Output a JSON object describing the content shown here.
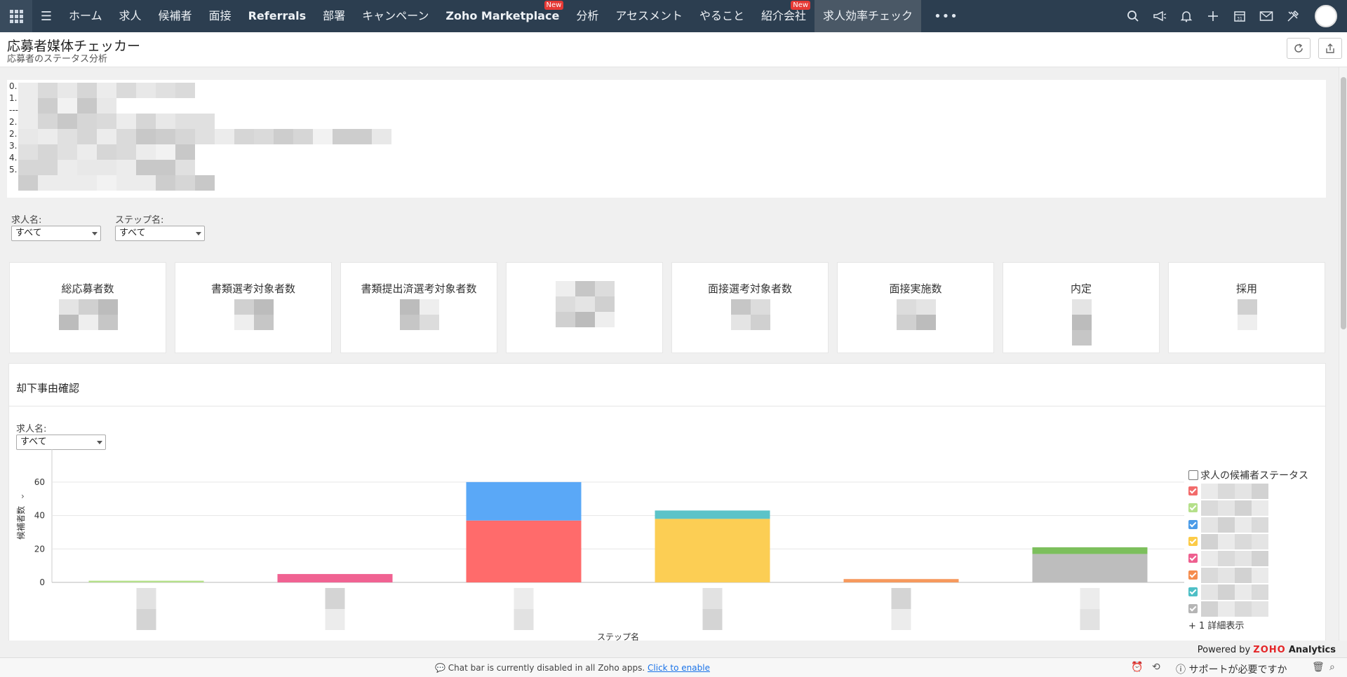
{
  "nav": {
    "items": [
      {
        "label": "ホーム",
        "bold": false,
        "badge": "",
        "active": false
      },
      {
        "label": "求人",
        "bold": false,
        "badge": "",
        "active": false
      },
      {
        "label": "候補者",
        "bold": false,
        "badge": "",
        "active": false
      },
      {
        "label": "面接",
        "bold": false,
        "badge": "",
        "active": false
      },
      {
        "label": "Referrals",
        "bold": true,
        "badge": "",
        "active": false
      },
      {
        "label": "部署",
        "bold": false,
        "badge": "",
        "active": false
      },
      {
        "label": "キャンペーン",
        "bold": false,
        "badge": "",
        "active": false
      },
      {
        "label": "Zoho Marketplace",
        "bold": true,
        "badge": "New",
        "active": false
      },
      {
        "label": "分析",
        "bold": false,
        "badge": "",
        "active": false
      },
      {
        "label": "アセスメント",
        "bold": false,
        "badge": "",
        "active": false
      },
      {
        "label": "やること",
        "bold": false,
        "badge": "",
        "active": false
      },
      {
        "label": "紹介会社",
        "bold": false,
        "badge": "New",
        "active": false
      },
      {
        "label": "求人効率チェック",
        "bold": false,
        "badge": "",
        "active": true
      }
    ],
    "more_label": "•••",
    "right_icons": [
      "search-icon",
      "megaphone-icon",
      "bell-icon",
      "plus-icon",
      "calendar-icon",
      "mail-icon",
      "tools-icon"
    ]
  },
  "header": {
    "title": "応募者媒体チェッカー",
    "subtitle": "応募者のステータス分析"
  },
  "info": {
    "lines": [
      "0.",
      "1.",
      "---",
      "2.",
      "2.",
      "3.",
      "4.",
      "5."
    ]
  },
  "filters": {
    "job_label": "求人名:",
    "job_value": "すべて",
    "step_label": "ステップ名:",
    "step_value": "すべて"
  },
  "kpis": [
    "総応募者数",
    "書類選考対象者数",
    "書類提出済選考対象者数",
    "",
    "面接選考対象者数",
    "面接実施数",
    "内定",
    "採用"
  ],
  "rejection": {
    "title": "却下事由確認",
    "job_label": "求人名:",
    "job_value": "すべて"
  },
  "chart_data": {
    "type": "bar",
    "stacked": true,
    "ylabel": "候補者数",
    "xlabel": "ステップ名",
    "yticks": [
      0,
      20,
      40,
      60
    ],
    "ylim": [
      0,
      70
    ],
    "categories": [
      "",
      "",
      "",
      "",
      "",
      ""
    ],
    "series": [
      {
        "color": "#ff6b6b",
        "values": [
          0,
          0,
          37,
          0,
          0,
          0
        ]
      },
      {
        "color": "#b5e08a",
        "values": [
          1,
          0,
          0,
          0,
          0,
          0
        ]
      },
      {
        "color": "#5aa8f7",
        "values": [
          0,
          0,
          23,
          0,
          0,
          0
        ]
      },
      {
        "color": "#fcce54",
        "values": [
          0,
          0,
          0,
          38,
          0,
          0
        ]
      },
      {
        "color": "#f06292",
        "values": [
          0,
          5,
          0,
          0,
          0,
          0
        ]
      },
      {
        "color": "#f6995d",
        "values": [
          0,
          0,
          0,
          0,
          2,
          0
        ]
      },
      {
        "color": "#5cc3c8",
        "values": [
          0,
          0,
          0,
          5,
          0,
          0
        ]
      },
      {
        "color": "#bdbdbd",
        "values": [
          0,
          0,
          0,
          0,
          0,
          17
        ]
      },
      {
        "color": "#7cbf5c",
        "values": [
          0,
          0,
          0,
          0,
          0,
          4
        ]
      }
    ],
    "legend_position": "right",
    "grid": true
  },
  "legend": {
    "title": "求人の候補者ステータス",
    "colors": [
      "#f26b6b",
      "#b5e08a",
      "#4c9ce8",
      "#fccb47",
      "#ee5f8f",
      "#f58d4f",
      "#4ebfc6",
      "#b5b5b5"
    ],
    "more": "+ 1 詳細表示"
  },
  "footer": {
    "powered_prefix": "Powered by",
    "brand": "ZOHO",
    "product": "Analytics"
  },
  "bottom": {
    "chat_msg": "Chat bar is currently disabled in all Zoho apps.",
    "chat_link": "Click to enable",
    "support": "サポートが必要ですか"
  }
}
